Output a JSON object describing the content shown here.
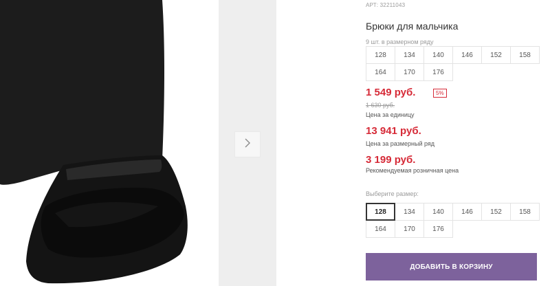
{
  "product": {
    "article": "АРТ: 32211043",
    "title": "Брюки для мальчика",
    "pack_note": "9 шт. в размерном ряду",
    "pack_sizes": [
      "128",
      "134",
      "140",
      "146",
      "152",
      "158",
      "164",
      "170",
      "176"
    ],
    "price": "1 549 руб.",
    "discount_badge": "5%",
    "old_price": "1 630 руб.",
    "unit_price_label": "Цена за единицу",
    "pack_price": "13 941 руб.",
    "pack_price_label": "Цена за размерный ряд",
    "rrp": "3 199 руб.",
    "rrp_label": "Рекомендуемая розничная цена",
    "choose_size_label": "Выберите размер:",
    "sizes": [
      "128",
      "134",
      "140",
      "146",
      "152",
      "158",
      "164",
      "170",
      "176"
    ],
    "selected_size": "128",
    "add_to_cart": "ДОБАВИТЬ В КОРЗИНУ"
  },
  "icons": {
    "next": "chevron-right-icon"
  },
  "colors": {
    "price": "#d62a37",
    "button": "#7d629c"
  }
}
